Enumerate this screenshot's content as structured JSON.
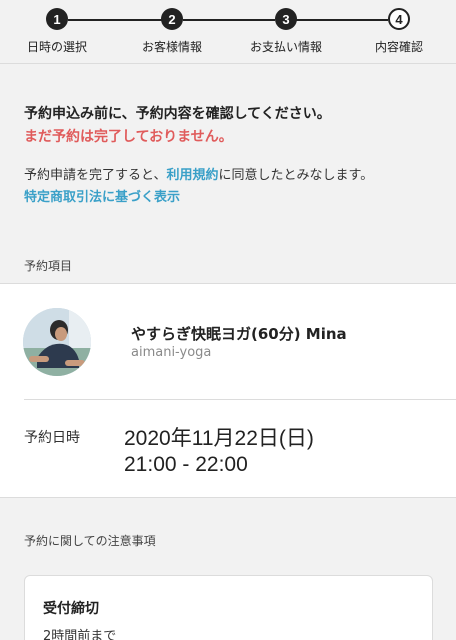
{
  "stepper": {
    "steps": [
      {
        "number": "1",
        "label": "日時の選択"
      },
      {
        "number": "2",
        "label": "お客様情報"
      },
      {
        "number": "3",
        "label": "お支払い情報"
      },
      {
        "number": "4",
        "label": "内容確認"
      }
    ],
    "current_step": "4"
  },
  "notice": {
    "line1": "予約申込み前に、予約内容を確認してください。",
    "line2": "まだ予約は完了しておりません。",
    "terms_prefix": "予約申請を完了すると、",
    "terms_link": "利用規約",
    "terms_suffix": "に同意したとみなします。",
    "commerce_link": "特定商取引法に基づく表示"
  },
  "reservation_item": {
    "section_label": "予約項目",
    "lesson_title": "やすらぎ快眠ヨガ(60分) Mina",
    "shop_name": "aimani-yoga",
    "datetime_label": "予約日時",
    "date": "2020年11月22日(日)",
    "time": "21:00 - 22:00"
  },
  "notes": {
    "section_label": "予約に関しての注意事項",
    "deadline_heading": "受付締切",
    "deadline_value": "2時間前まで"
  },
  "colors": {
    "accent_link": "#3aa0c8",
    "warning": "#e05b5b",
    "dark": "#222222"
  }
}
